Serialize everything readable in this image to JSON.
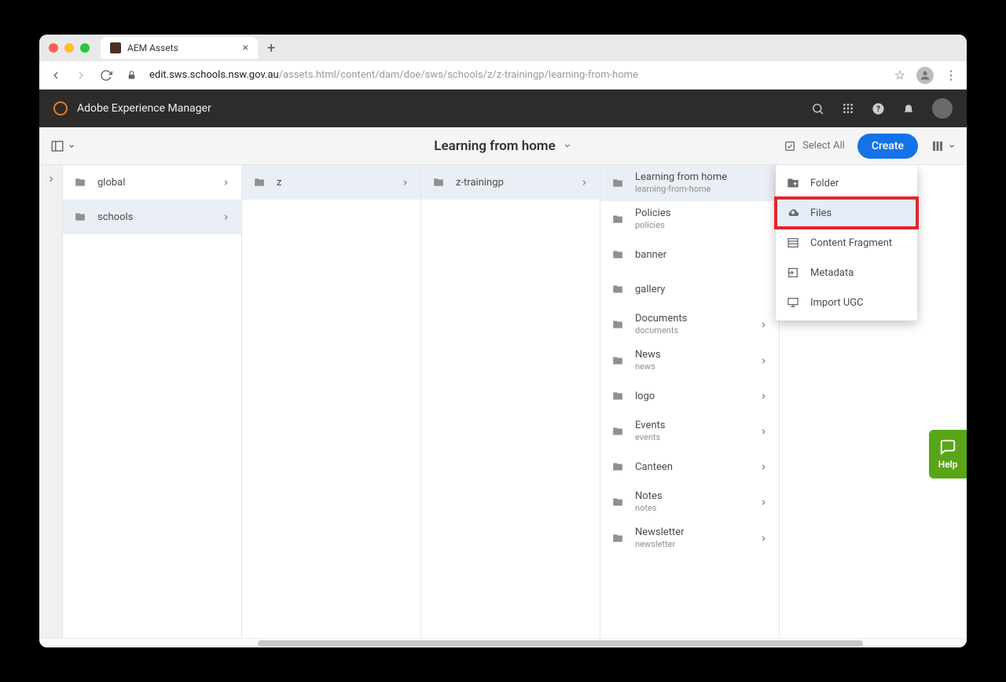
{
  "browser": {
    "tab_title": "AEM Assets",
    "url_host": "edit.sws.schools.nsw.gov.au",
    "url_path": "/assets.html/content/dam/doe/sws/schools/z/z-trainingp/learning-from-home"
  },
  "header": {
    "brand": "Adobe Experience Manager"
  },
  "toolbar": {
    "title": "Learning from home",
    "select_all": "Select All",
    "create": "Create"
  },
  "columns": [
    {
      "items": [
        {
          "label": "global",
          "has_children": true,
          "selected": false
        },
        {
          "label": "schools",
          "has_children": true,
          "selected": true
        }
      ]
    },
    {
      "items": [
        {
          "label": "z",
          "has_children": true,
          "selected": true
        }
      ]
    },
    {
      "items": [
        {
          "label": "z-trainingp",
          "has_children": true,
          "selected": true
        }
      ]
    },
    {
      "items": [
        {
          "label": "Learning from home",
          "sublabel": "learning-from-home",
          "has_children": false,
          "selected": true
        },
        {
          "label": "Policies",
          "sublabel": "policies",
          "has_children": false
        },
        {
          "label": "banner",
          "has_children": false
        },
        {
          "label": "gallery",
          "has_children": false
        },
        {
          "label": "Documents",
          "sublabel": "documents",
          "has_children": true
        },
        {
          "label": "News",
          "sublabel": "news",
          "has_children": true
        },
        {
          "label": "logo",
          "has_children": true
        },
        {
          "label": "Events",
          "sublabel": "events",
          "has_children": true
        },
        {
          "label": "Canteen",
          "has_children": true
        },
        {
          "label": "Notes",
          "sublabel": "notes",
          "has_children": true
        },
        {
          "label": "Newsletter",
          "sublabel": "newsletter",
          "has_children": true
        }
      ]
    }
  ],
  "create_menu": [
    {
      "label": "Folder",
      "icon": "folder-plus"
    },
    {
      "label": "Files",
      "icon": "cloud-upload",
      "highlight": true
    },
    {
      "label": "Content Fragment",
      "icon": "fragment"
    },
    {
      "label": "Metadata",
      "icon": "import"
    },
    {
      "label": "Import UGC",
      "icon": "monitor"
    }
  ],
  "help": {
    "label": "Help"
  }
}
